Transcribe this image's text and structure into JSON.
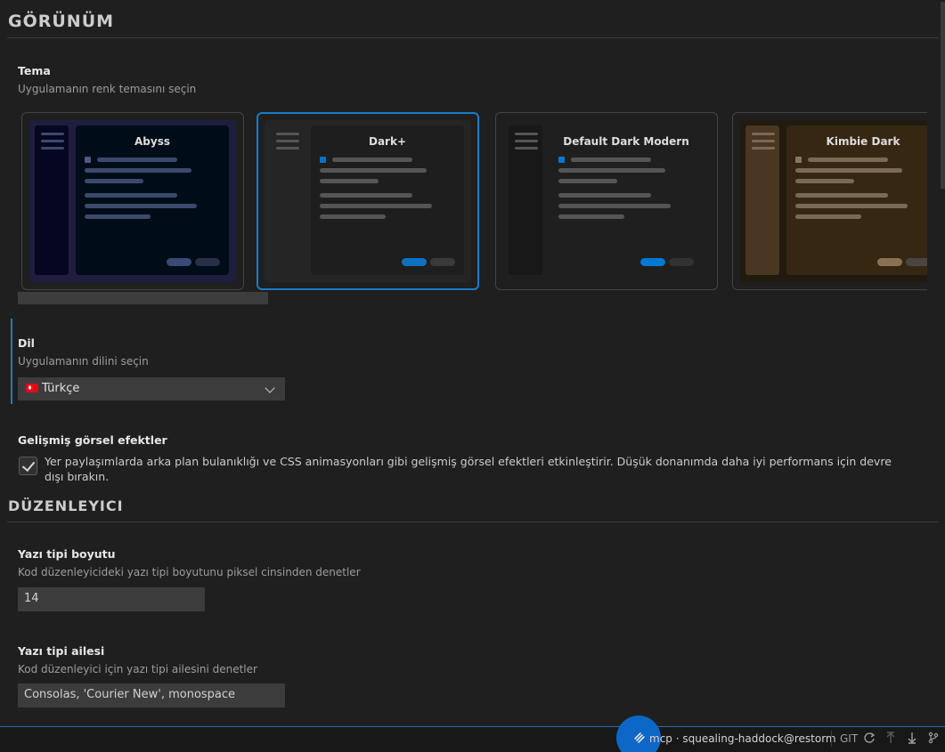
{
  "sections": {
    "appearance": "GÖRÜNÜM",
    "editor": "DÜZENLEYICI"
  },
  "theme": {
    "label": "Tema",
    "description": "Uygulamanın renk temasını seçin",
    "selected": "Dark+",
    "cards": [
      {
        "name": "Abyss",
        "outer": "#1e1e3e",
        "inner": "#000c18",
        "sidebar": "#060621",
        "title_color": "#dddddd",
        "line": "#3b4a6b",
        "accent": "#4d5a87",
        "btn_primary": "#3a4a74",
        "btn_secondary": "#2a2f45"
      },
      {
        "name": "Dark+",
        "outer": "#252526",
        "inner": "#1e1e1e",
        "sidebar": "#252526",
        "title_color": "#dddddd",
        "line": "#555555",
        "accent": "#0e70c0",
        "btn_primary": "#0e70c0",
        "btn_secondary": "#3a3a3a"
      },
      {
        "name": "Default Dark Modern",
        "outer": "#1f1f1f",
        "inner": "#1f1f1f",
        "sidebar": "#181818",
        "title_color": "#dddddd",
        "line": "#555555",
        "accent": "#0078d4",
        "btn_primary": "#0078d4",
        "btn_secondary": "#313131"
      },
      {
        "name": "Kimbie Dark",
        "outer": "#221a0f",
        "inner": "#362712",
        "sidebar": "#4a3721",
        "title_color": "#dddddd",
        "line": "#7a6a55",
        "accent": "#8a7660",
        "btn_primary": "#8a7152",
        "btn_secondary": "#4a4540"
      }
    ]
  },
  "language": {
    "label": "Dil",
    "description": "Uygulamanın dilini seçin",
    "selected": "Türkçe",
    "flag_icon": "turkey-flag-icon"
  },
  "effects": {
    "label": "Gelişmiş görsel efektler",
    "checked": true,
    "text": "Yer paylaşımlarda arka plan bulanıklığı ve CSS animasyonları gibi gelişmiş görsel efektleri etkinleştirir. Düşük donanımda daha iyi performans için devre dışı bırakın."
  },
  "font_size": {
    "label": "Yazı tipi boyutu",
    "description": "Kod düzenleyicideki yazı tipi boyutunu piksel cinsinden denetler",
    "value": "14"
  },
  "font_family": {
    "label": "Yazı tipi ailesi",
    "description": "Kod düzenleyici için yazı tipi ailesini denetler",
    "value": "Consolas, 'Courier New', monospace"
  },
  "statusbar": {
    "remote": "mcp · squealing-haddock@restorm",
    "git": "GIT",
    "accent": "#0c67c6"
  }
}
